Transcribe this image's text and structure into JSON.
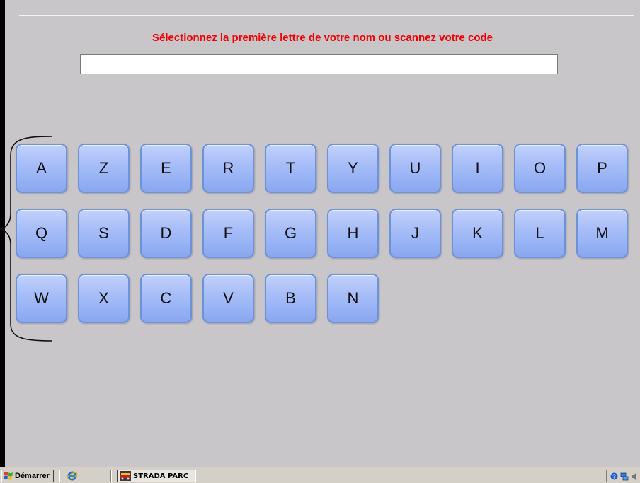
{
  "prompt": "Sélectionnez la première lettre de votre nom ou scannez votre code",
  "search": {
    "value": "",
    "placeholder": ""
  },
  "keyboard": {
    "row1": [
      "A",
      "Z",
      "E",
      "R",
      "T",
      "Y",
      "U",
      "I",
      "O",
      "P"
    ],
    "row2": [
      "Q",
      "S",
      "D",
      "F",
      "G",
      "H",
      "J",
      "K",
      "L",
      "M"
    ],
    "row3": [
      "W",
      "X",
      "C",
      "V",
      "B",
      "N"
    ]
  },
  "taskbar": {
    "start_label": "Démarrer",
    "tasks": [
      {
        "label": "STRADA PARC"
      }
    ],
    "icons": [
      "windows-flag-icon",
      "internet-explorer-icon",
      "strada-parc-app-icon",
      "help-icon",
      "network-icon",
      "speaker-icon"
    ]
  },
  "colors": {
    "background": "#c8c6c8",
    "prompt": "#f00000",
    "key_fill": "#a8bef8",
    "key_border": "#6e92d8"
  }
}
